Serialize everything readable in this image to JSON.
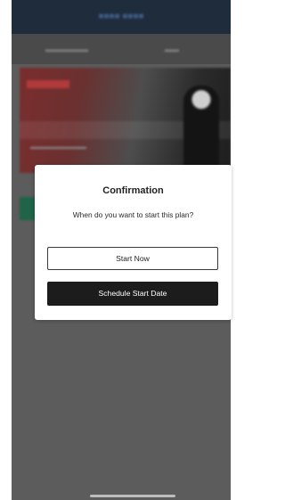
{
  "dialog": {
    "title": "Confirmation",
    "message": "When do you want to start this plan?",
    "start_now_label": "Start Now",
    "schedule_label": "Schedule Start Date"
  },
  "colors": {
    "backdrop": "#5c5c5c",
    "nav_bar": "#1f2c3c",
    "primary_button": "#1c1c1c",
    "accent_green": "#1e6448"
  }
}
